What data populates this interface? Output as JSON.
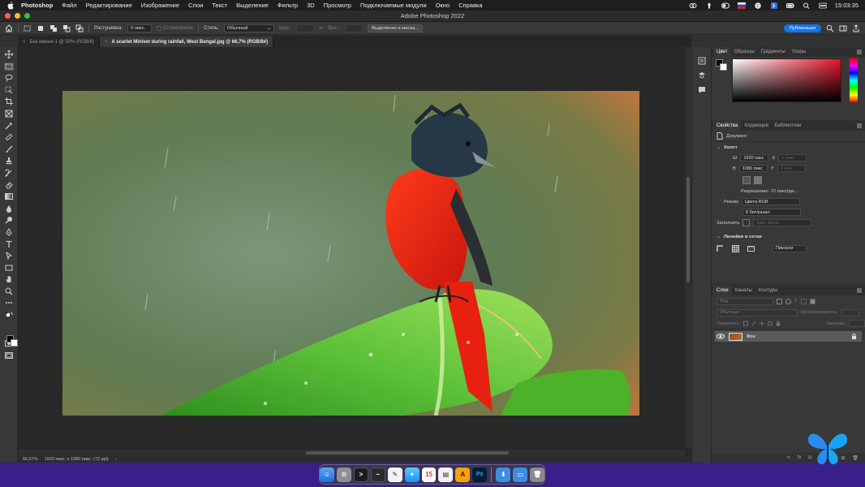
{
  "menubar": {
    "app": "Photoshop",
    "items": [
      "Файл",
      "Редактирование",
      "Изображение",
      "Слои",
      "Текст",
      "Выделение",
      "Фильтр",
      "3D",
      "Просмотр",
      "Подключаемые модули",
      "Окно",
      "Справка"
    ],
    "clock": "15:03:35"
  },
  "window": {
    "title": "Adobe Photoshop 2022"
  },
  "options": {
    "feather_label": "Растушевка:",
    "feather_value": "0 пикс.",
    "antialias": "Сглаживание",
    "style_label": "Стиль:",
    "style_value": "Обычный",
    "width_label": "Шир.:",
    "height_label": "Выс.:",
    "select_mask": "Выделение и маска...",
    "publish": "Публикация"
  },
  "tabs": [
    {
      "label": "Без имени-1 @ 50% (RGB/8)",
      "close": "×"
    },
    {
      "label": "A scarlet Minivet during rainfall, West Bengal.jpg @ 66,7% (RGB/8#)",
      "close": "×"
    }
  ],
  "status": {
    "zoom": "66,67%",
    "doc_info": "1920 пикс. x 1080 пикс. (72 ppi)",
    "arrow": "›"
  },
  "color_panel": {
    "tabs": [
      "Цвет",
      "Образцы",
      "Градиенты",
      "Узоры"
    ]
  },
  "properties": {
    "tabs": [
      "Свойства",
      "Коррекция",
      "Библиотеки"
    ],
    "doc_label": "Документ",
    "canvas_section": "Холст",
    "w_label": "Ш",
    "w_value": "1920 пикс",
    "x_label": "X",
    "x_value": "0 пикс",
    "h_label": "В",
    "h_value": "1080 пикс",
    "y_label": "Y",
    "y_value": "0 пикс",
    "resolution": "Разрешение: 72 пикс/дю...",
    "mode_label": "Режим",
    "mode_value": "Цвета RGB",
    "depth_value": "8 бит/канал",
    "fill_label": "Заполнить",
    "fill_value": "Цвет фона",
    "rulers_section": "Линейки и сетки",
    "units_value": "Пиксели"
  },
  "layers": {
    "tabs": [
      "Слои",
      "Каналы",
      "Контуры"
    ],
    "search_placeholder": "Вид",
    "blend_mode": "Обычные",
    "opacity_label": "Непрозрачность:",
    "lock_label": "Закрепить:",
    "fill_label": "Заливка:",
    "items": [
      {
        "name": "Фон"
      }
    ]
  },
  "colors": {
    "accent": "#1473e6",
    "panel_bg": "#383838",
    "canvas_bg": "#282828"
  }
}
